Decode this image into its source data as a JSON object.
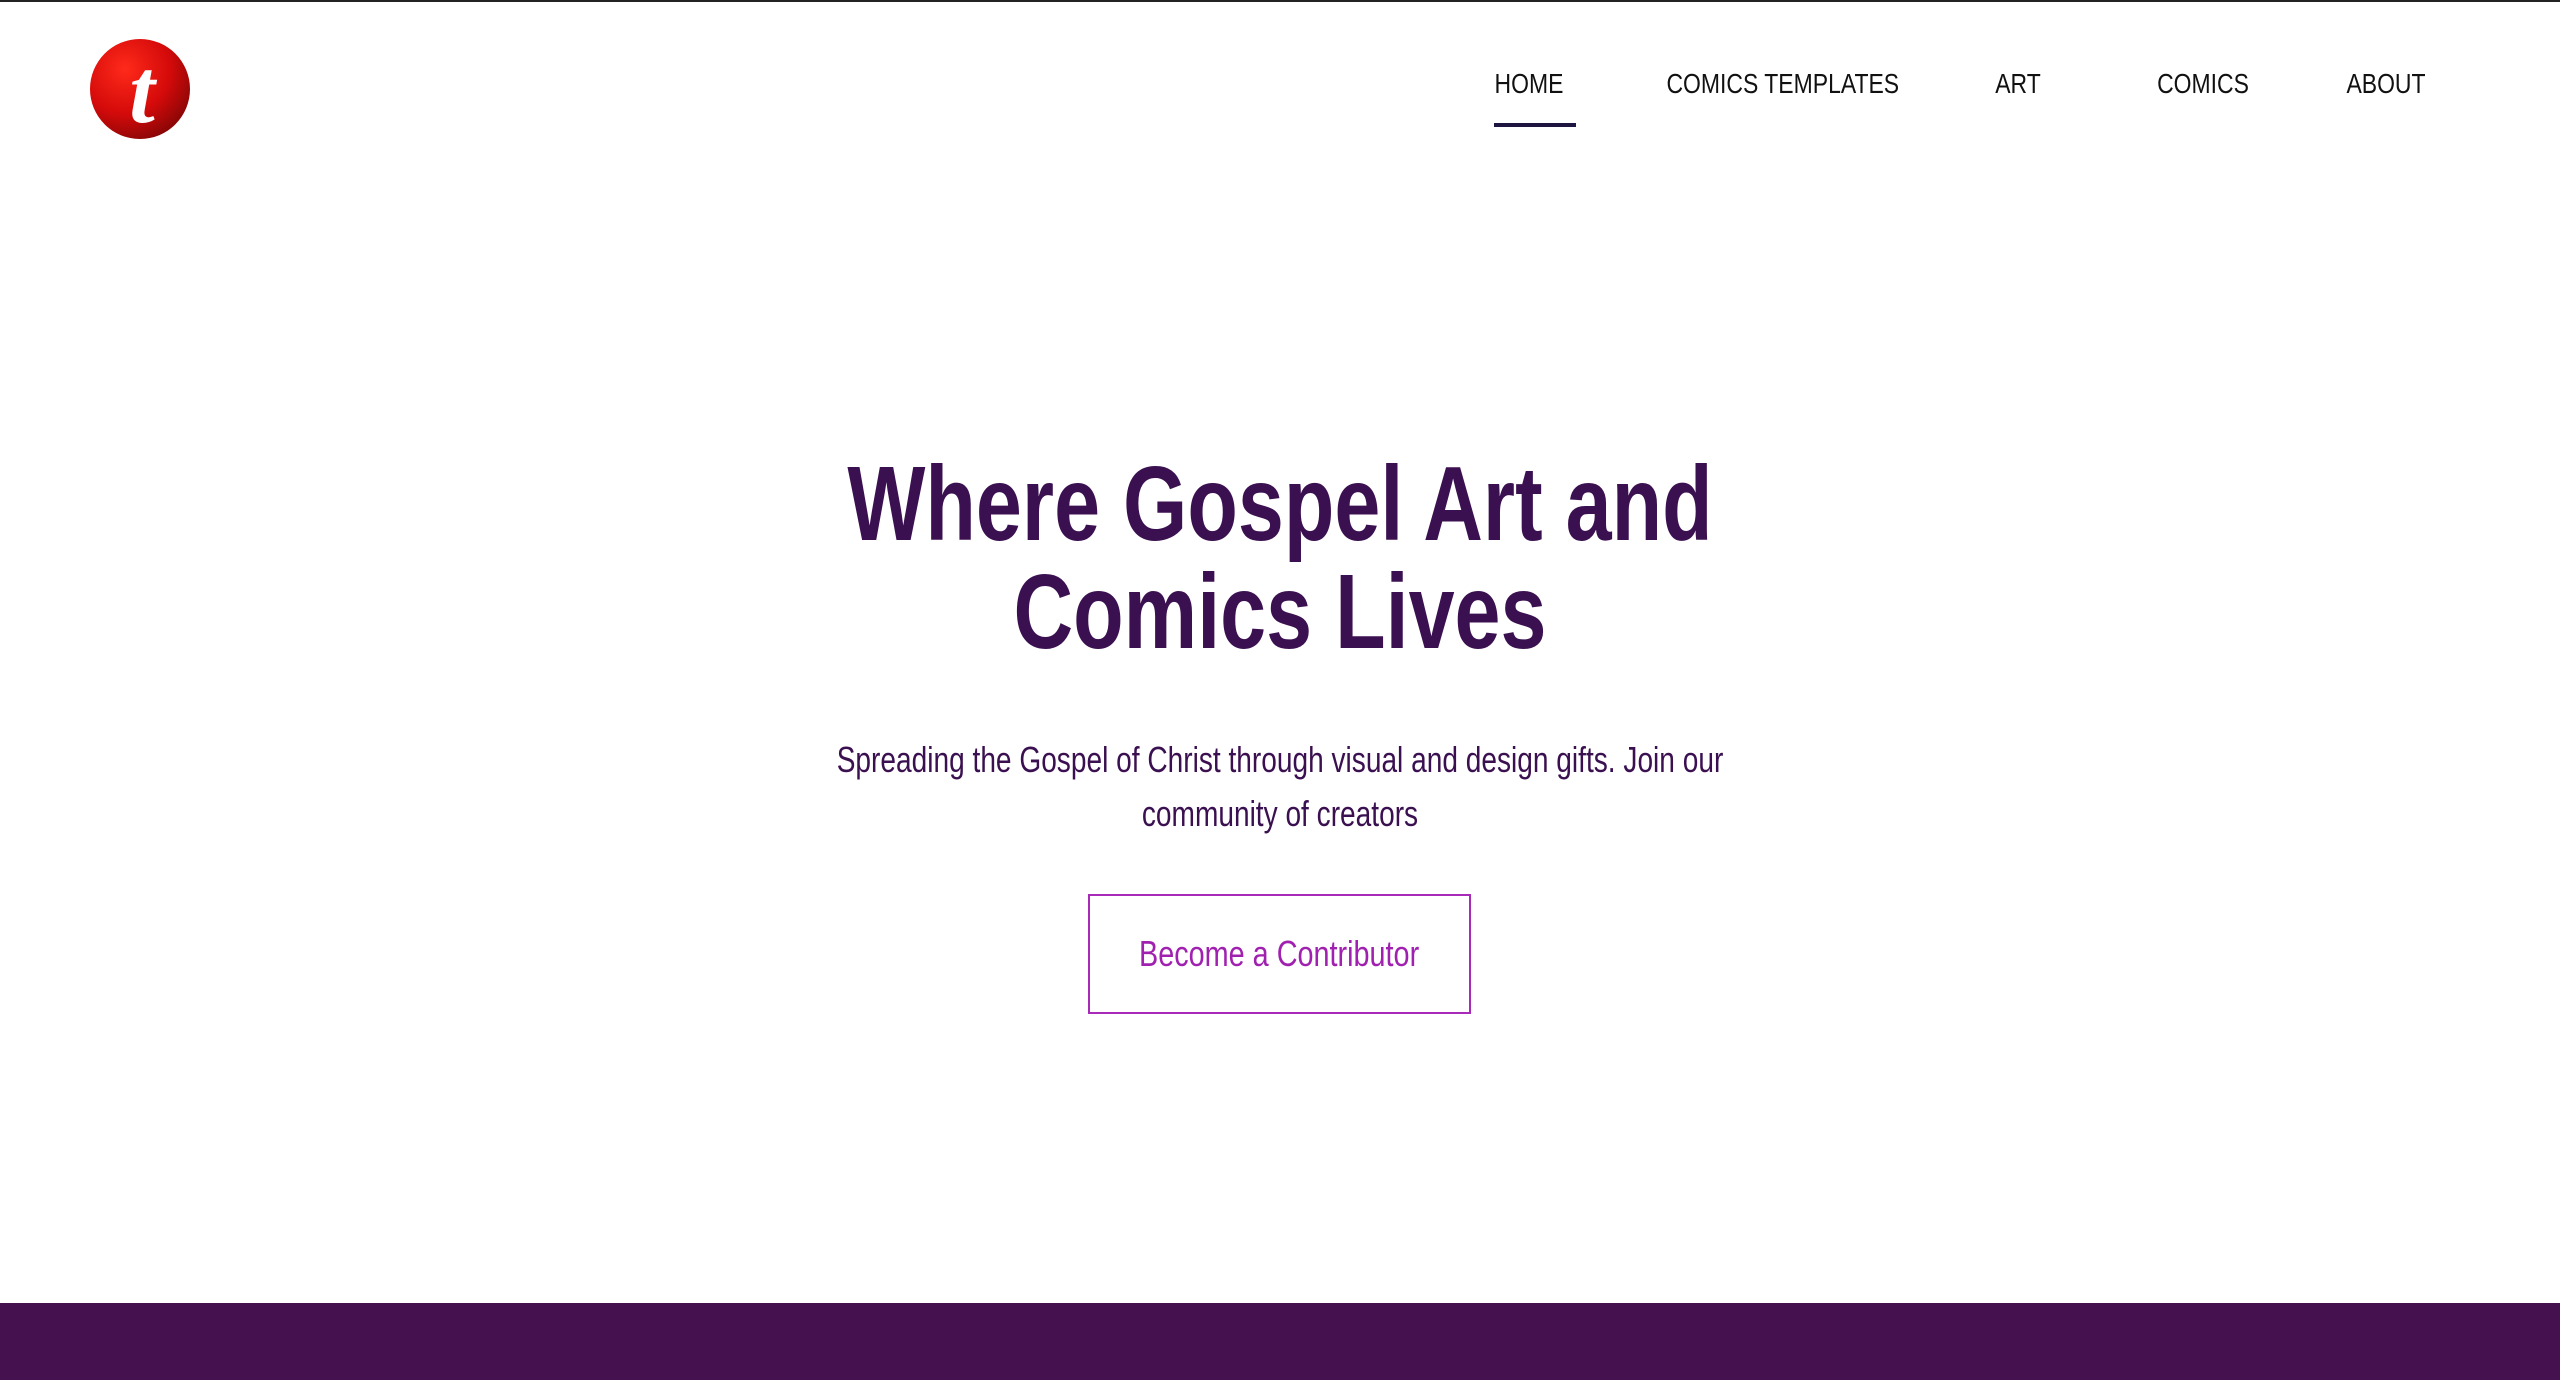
{
  "header": {
    "logo_letter": "t",
    "nav": [
      {
        "label": "HOME",
        "active": true
      },
      {
        "label": "COMICS TEMPLATES",
        "active": false
      },
      {
        "label": "ART",
        "active": false
      },
      {
        "label": "COMICS",
        "active": false
      },
      {
        "label": "ABOUT",
        "active": false
      }
    ]
  },
  "hero": {
    "title": "Where Gospel Art and Comics Lives",
    "subtitle": "Spreading the Gospel of Christ through visual and design gifts. Join our community of creators",
    "cta_label": "Become a Contributor"
  },
  "colors": {
    "brand_purple": "#45124f",
    "title_purple": "#3b1050",
    "cta_magenta": "#a82ab8",
    "logo_red": "#d40a0a",
    "active_underline": "#1e1540"
  },
  "icons": {
    "logo": "red-circle-t-logo"
  }
}
